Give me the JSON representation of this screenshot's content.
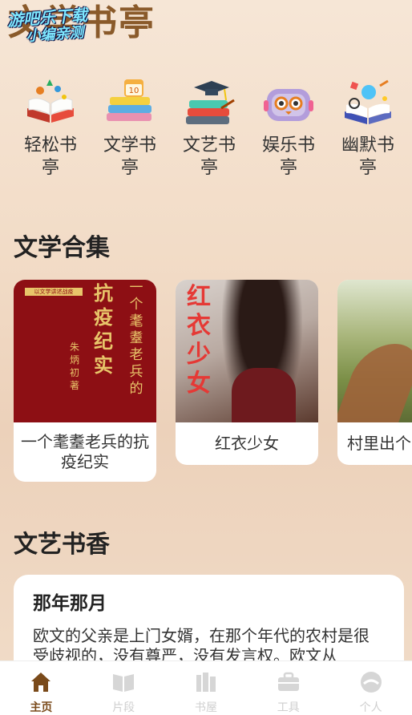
{
  "header": {
    "title": "文学书亭",
    "watermark": [
      "游吧乐下载",
      "小编亲测"
    ]
  },
  "categories": [
    {
      "label": "轻松书亭",
      "icon": "open-book-icon"
    },
    {
      "label": "文学书亭",
      "icon": "book-stack-calendar-icon"
    },
    {
      "label": "文艺书亭",
      "icon": "graduation-books-icon"
    },
    {
      "label": "娱乐书亭",
      "icon": "robot-icon"
    },
    {
      "label": "幽默书亭",
      "icon": "science-book-icon"
    }
  ],
  "sections": {
    "collection_title": "文学合集",
    "literary_title": "文艺书香"
  },
  "books": [
    {
      "title": "一个耄耋老兵的抗疫纪实",
      "cover_text": "抗疫纪实",
      "cover_subtext": "一个耄耋老兵的",
      "cover_author": "朱炳初 著",
      "cover_top_label": "以文学讲述战疫"
    },
    {
      "title": "红衣少女",
      "cover_text": "红衣少女"
    },
    {
      "title": "村里出个"
    }
  ],
  "article": {
    "title": "那年那月",
    "body": "欧文的父亲是上门女婿，在那个年代的农村是很受歧视的，没有尊严，没有发言权。欧文从"
  },
  "tabbar": [
    {
      "label": "主页",
      "icon": "home-icon",
      "active": true
    },
    {
      "label": "片段",
      "icon": "book-open-icon",
      "active": false
    },
    {
      "label": "书屋",
      "icon": "bookshelf-icon",
      "active": false
    },
    {
      "label": "工具",
      "icon": "briefcase-icon",
      "active": false
    },
    {
      "label": "个人",
      "icon": "profile-icon",
      "active": false
    }
  ],
  "colors": {
    "accent_brown": "#7a4a1a",
    "cover_red": "#8d0f14",
    "cover_gold": "#e8c56a",
    "inactive_tab": "#cfcfcf"
  }
}
